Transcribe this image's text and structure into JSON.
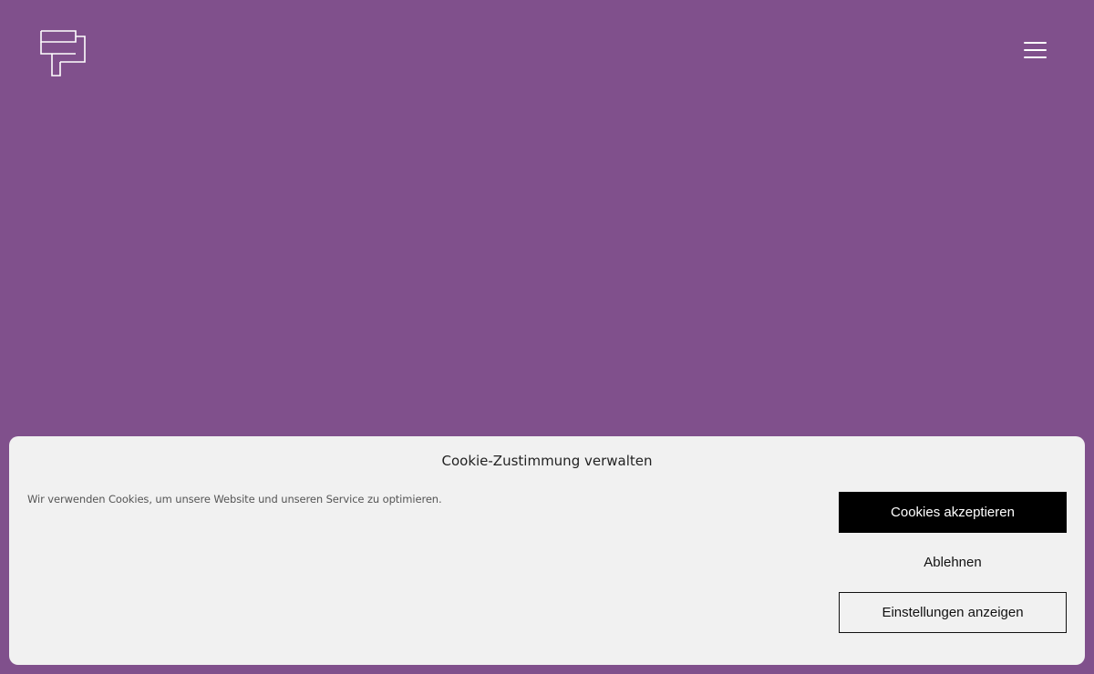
{
  "header": {
    "logo_icon": "brand-logo-icon",
    "menu_icon": "hamburger-menu-icon"
  },
  "colors": {
    "page_background": "#80508c",
    "banner_background": "#f1f1f1",
    "accept_button_background": "#000000"
  },
  "cookie_banner": {
    "title": "Cookie-Zustimmung verwalten",
    "message": "Wir verwenden Cookies, um unsere Website und unseren Service zu optimieren.",
    "accept_label": "Cookies akzeptieren",
    "deny_label": "Ablehnen",
    "preferences_label": "Einstellungen anzeigen"
  }
}
